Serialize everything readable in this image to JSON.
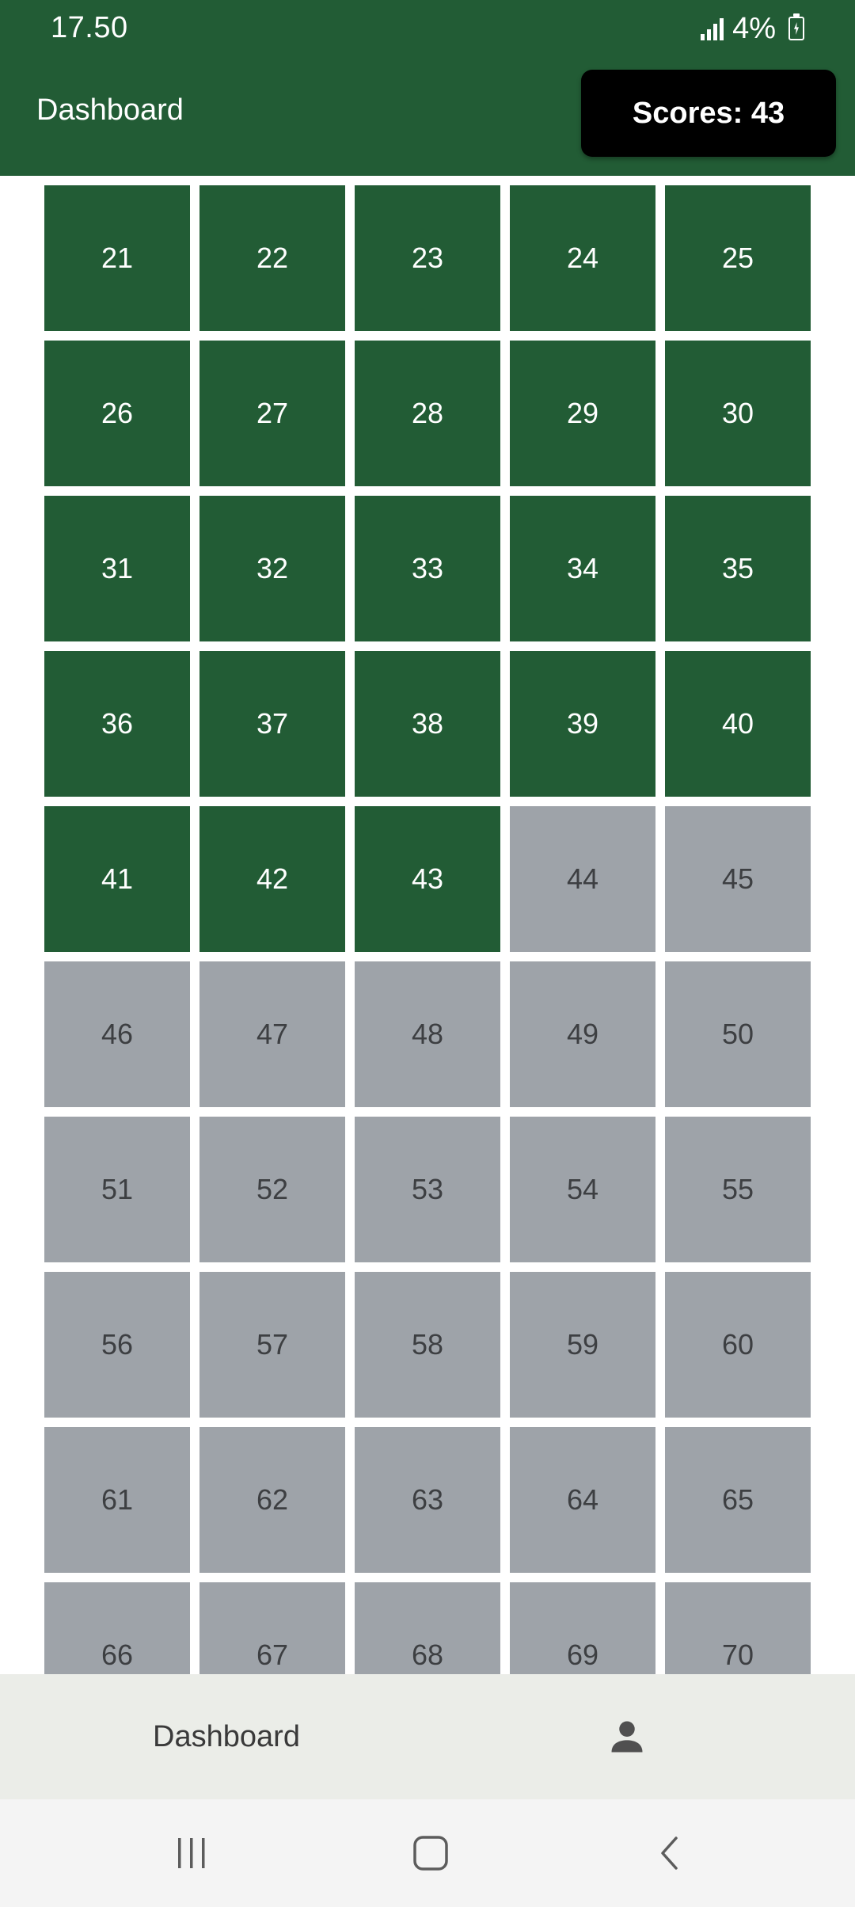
{
  "status_bar": {
    "time": "17.50",
    "battery": "4%",
    "icons": [
      "signal-icon",
      "battery-charging-icon"
    ]
  },
  "app_bar": {
    "title": "Dashboard",
    "score_label": "Scores: 43"
  },
  "grid": {
    "completed_color": "#225c35",
    "pending_color": "#9ea3a9",
    "last_completed": 43,
    "cells": [
      "21",
      "22",
      "23",
      "24",
      "25",
      "26",
      "27",
      "28",
      "29",
      "30",
      "31",
      "32",
      "33",
      "34",
      "35",
      "36",
      "37",
      "38",
      "39",
      "40",
      "41",
      "42",
      "43",
      "44",
      "45",
      "46",
      "47",
      "48",
      "49",
      "50",
      "51",
      "52",
      "53",
      "54",
      "55",
      "56",
      "57",
      "58",
      "59",
      "60",
      "61",
      "62",
      "63",
      "64",
      "65",
      "66",
      "67",
      "68",
      "69",
      "70"
    ]
  },
  "bottom_nav": {
    "dashboard_label": "Dashboard",
    "profile_icon": "person-icon"
  },
  "system_nav": {
    "icons": [
      "recent-apps-icon",
      "home-icon",
      "back-icon"
    ]
  }
}
